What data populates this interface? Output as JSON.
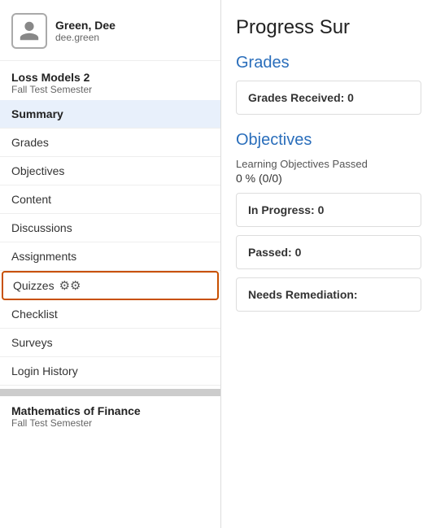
{
  "user": {
    "name": "Green, Dee",
    "login": "dee.green"
  },
  "course1": {
    "name": "Loss Models 2",
    "semester": "Fall Test Semester"
  },
  "course2": {
    "name": "Mathematics of Finance",
    "semester": "Fall Test Semester"
  },
  "nav": {
    "items": [
      {
        "label": "Summary",
        "active": true,
        "highlighted": false,
        "id": "summary"
      },
      {
        "label": "Grades",
        "active": false,
        "highlighted": false,
        "id": "grades"
      },
      {
        "label": "Objectives",
        "active": false,
        "highlighted": false,
        "id": "objectives"
      },
      {
        "label": "Content",
        "active": false,
        "highlighted": false,
        "id": "content"
      },
      {
        "label": "Discussions",
        "active": false,
        "highlighted": false,
        "id": "discussions"
      },
      {
        "label": "Assignments",
        "active": false,
        "highlighted": false,
        "id": "assignments"
      },
      {
        "label": "Quizzes",
        "active": false,
        "highlighted": true,
        "id": "quizzes"
      },
      {
        "label": "Checklist",
        "active": false,
        "highlighted": false,
        "id": "checklist"
      },
      {
        "label": "Surveys",
        "active": false,
        "highlighted": false,
        "id": "surveys"
      },
      {
        "label": "Login History",
        "active": false,
        "highlighted": false,
        "id": "login-history"
      }
    ]
  },
  "main": {
    "title": "Progress Sur",
    "grades_section": {
      "heading": "Grades",
      "card_label": "Grades Received: 0"
    },
    "objectives_section": {
      "heading": "Objectives",
      "subtitle": "Learning Objectives Passed",
      "pct": "0 % (0/0)",
      "in_progress_label": "In Progress: 0",
      "passed_label": "Passed: 0",
      "needs_remediation_label": "Needs Remediation:"
    }
  }
}
